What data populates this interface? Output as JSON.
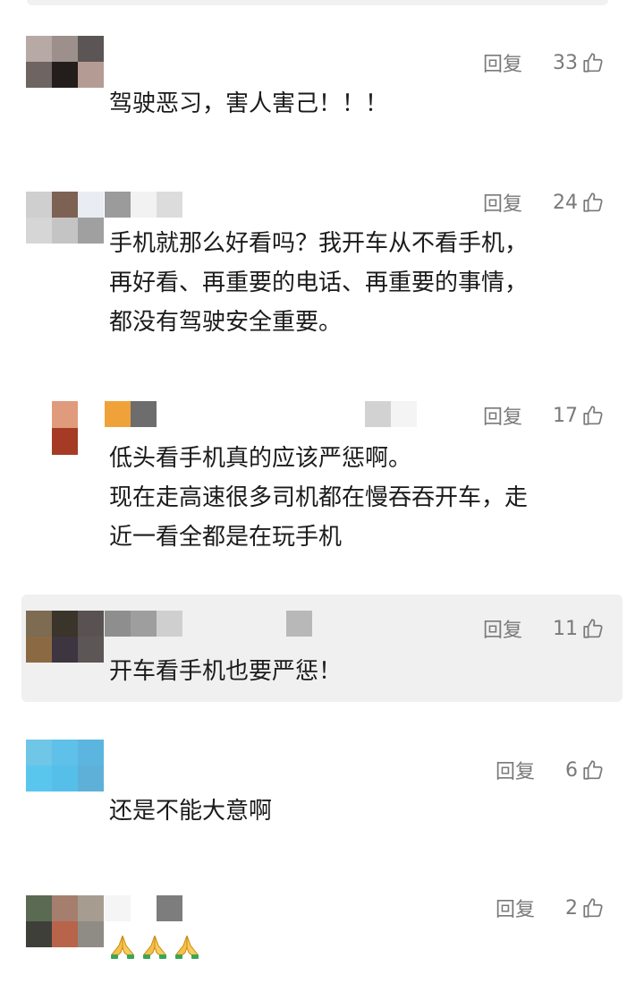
{
  "ui": {
    "reply_label": "回复"
  },
  "comments": [
    {
      "likes": "33",
      "lines": [
        "驾驶恶习，害人害己！！！"
      ]
    },
    {
      "likes": "24",
      "lines": [
        "手机就那么好看吗？我开车从不看手机，",
        "再好看、再重要的电话、再重要的事情，",
        "都没有驾驶安全重要。"
      ]
    },
    {
      "likes": "17",
      "lines": [
        "低头看手机真的应该严惩啊。",
        "现在走高速很多司机都在慢吞吞开车，走",
        "近一看全都是在玩手机"
      ]
    },
    {
      "likes": "11",
      "lines": [
        "开车看手机也要严惩！"
      ]
    },
    {
      "likes": "6",
      "lines": [
        "还是不能大意啊"
      ]
    },
    {
      "likes": "2",
      "emoji_count": 3
    }
  ],
  "colors": {
    "text": "#1b1b1b",
    "meta": "#7a7a7a",
    "highlight_bg": "#f0f0f0"
  }
}
